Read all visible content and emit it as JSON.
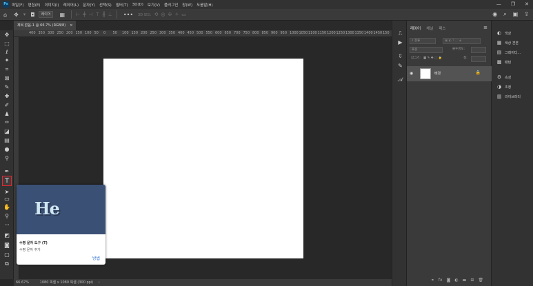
{
  "app": {
    "logo": "Ps"
  },
  "menu": [
    "파일(F)",
    "편집(E)",
    "이미지(I)",
    "레이어(L)",
    "문자(Y)",
    "선택(S)",
    "필터(T)",
    "3D(D)",
    "보기(V)",
    "플러그인",
    "창(W)",
    "도움말(H)"
  ],
  "window_controls": [
    "—",
    "❐",
    "✕"
  ],
  "options_bar": {
    "layer_dropdown": "레이어",
    "mode_3d": "3D 모드:"
  },
  "document": {
    "tab_title": "제목 없음-1 @ 66.7% (RGB/8)",
    "close": "×"
  },
  "ruler_ticks": [
    "400",
    "350",
    "300",
    "250",
    "200",
    "150",
    "100",
    "50",
    "0",
    "50",
    "100",
    "150",
    "200",
    "250",
    "300",
    "350",
    "400",
    "450",
    "500",
    "550",
    "600",
    "650",
    "700",
    "750",
    "800",
    "850",
    "900",
    "950",
    "1000",
    "1050",
    "1100",
    "1150",
    "1200",
    "1250",
    "1300",
    "1350",
    "1400",
    "1450",
    "150"
  ],
  "tooltip": {
    "logo_text": "He",
    "title": "수평 문자 도구 (T)",
    "description": "수평 문자 추가",
    "link": "방법"
  },
  "status": {
    "zoom": "66.67%",
    "info": "1080 픽셀 x 1080 픽셀 (300 ppi)",
    "arrow": "›"
  },
  "layers_panel": {
    "tabs": [
      "레이어",
      "채널",
      "패스"
    ],
    "filter_label": "종류",
    "blend_mode": "표준",
    "opacity_label": "불투명도:",
    "lock_label": "잠그기:",
    "fill_label": "칠:",
    "layer_name": "배경"
  },
  "right_panel": {
    "items": [
      "색상",
      "색상 견본",
      "그레이디...",
      "패턴",
      "속성",
      "조정",
      "라이브러리"
    ]
  }
}
